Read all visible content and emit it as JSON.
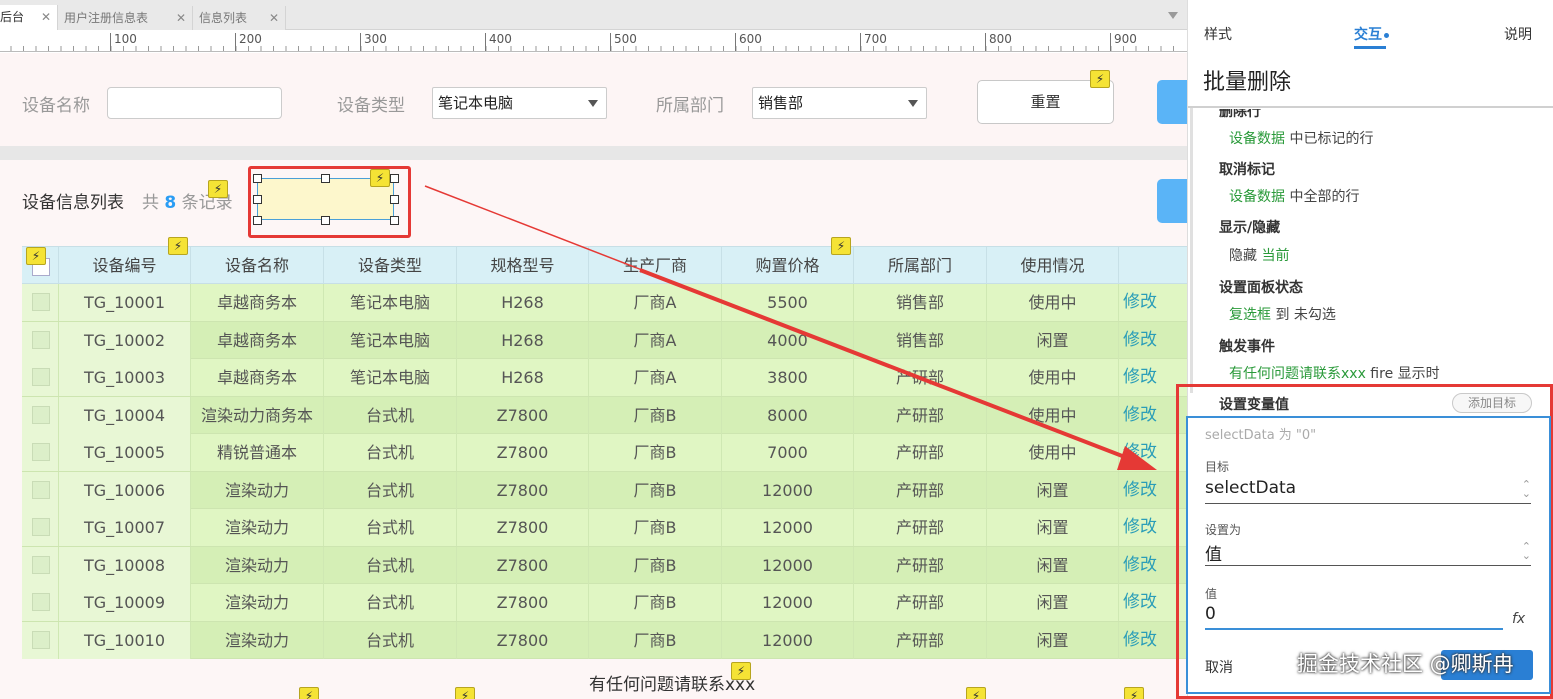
{
  "tabs": [
    {
      "label": "后台",
      "active": true
    },
    {
      "label": "用户注册信息表",
      "active": false
    },
    {
      "label": "信息列表",
      "active": false
    }
  ],
  "ruler": [
    "100",
    "200",
    "300",
    "400",
    "500",
    "600",
    "700",
    "800",
    "900"
  ],
  "filters": {
    "name_label": "设备名称",
    "name_value": "",
    "type_label": "设备类型",
    "type_value": "笔记本电脑",
    "dept_label": "所属部门",
    "dept_value": "销售部",
    "reset_label": "重置"
  },
  "list": {
    "title": "设备信息列表",
    "count_prefix": "共",
    "count": "8",
    "count_suffix": "条记录"
  },
  "table": {
    "headers": [
      "设备编号",
      "设备名称",
      "设备类型",
      "规格型号",
      "生产厂商",
      "购置价格",
      "所属部门",
      "使用情况"
    ],
    "edit_label": "修改",
    "rows": [
      [
        "TG_10001",
        "卓越商务本",
        "笔记本电脑",
        "H268",
        "厂商A",
        "5500",
        "销售部",
        "使用中"
      ],
      [
        "TG_10002",
        "卓越商务本",
        "笔记本电脑",
        "H268",
        "厂商A",
        "4000",
        "销售部",
        "闲置"
      ],
      [
        "TG_10003",
        "卓越商务本",
        "笔记本电脑",
        "H268",
        "厂商A",
        "3800",
        "产研部",
        "使用中"
      ],
      [
        "TG_10004",
        "渲染动力商务本",
        "台式机",
        "Z7800",
        "厂商B",
        "8000",
        "产研部",
        "使用中"
      ],
      [
        "TG_10005",
        "精锐普通本",
        "台式机",
        "Z7800",
        "厂商B",
        "7000",
        "产研部",
        "使用中"
      ],
      [
        "TG_10006",
        "渲染动力",
        "台式机",
        "Z7800",
        "厂商B",
        "12000",
        "产研部",
        "闲置"
      ],
      [
        "TG_10007",
        "渲染动力",
        "台式机",
        "Z7800",
        "厂商B",
        "12000",
        "产研部",
        "闲置"
      ],
      [
        "TG_10008",
        "渲染动力",
        "台式机",
        "Z7800",
        "厂商B",
        "12000",
        "产研部",
        "闲置"
      ],
      [
        "TG_10009",
        "渲染动力",
        "台式机",
        "Z7800",
        "厂商B",
        "12000",
        "产研部",
        "闲置"
      ],
      [
        "TG_10010",
        "渲染动力",
        "台式机",
        "Z7800",
        "厂商B",
        "12000",
        "产研部",
        "闲置"
      ]
    ]
  },
  "footer": {
    "contact": "有任何问题请联系xxx"
  },
  "panel": {
    "tabs": {
      "style": "样式",
      "interaction": "交互",
      "notes": "说明"
    },
    "title": "批量删除",
    "actions": [
      {
        "title": "删除行",
        "target": "设备数据",
        "detail": " 中已标记的行"
      },
      {
        "title": "取消标记",
        "target": "设备数据",
        "detail": " 中全部的行"
      },
      {
        "title": "显示/隐藏",
        "prefix": "隐藏 ",
        "target": "当前",
        "detail": ""
      },
      {
        "title": "设置面板状态",
        "target": "复选框",
        "detail": " 到 未勾选"
      },
      {
        "title": "触发事件",
        "target": "有任何问题请联系xxx",
        "detail": " fire 显示时"
      },
      {
        "title": "设置变量值",
        "target": "",
        "detail": ""
      }
    ],
    "add_target": "添加目标",
    "hint": "selectData 为 \"0\"",
    "target_label": "目标",
    "target_value": "selectData",
    "set_to_label": "设置为",
    "set_to_value": "值",
    "value_label": "值",
    "value_value": "0",
    "fx": "fx",
    "cancel": "取消",
    "watermark": "掘金技术社区 @卿斯冉"
  },
  "icons": {
    "bolt": "lightning-bolt-icon"
  },
  "colors": {
    "accent": "#2a7fd4",
    "highlight_red": "#e53935",
    "row_green": "#e0f6c3",
    "header_blue": "#d8f0f6"
  }
}
